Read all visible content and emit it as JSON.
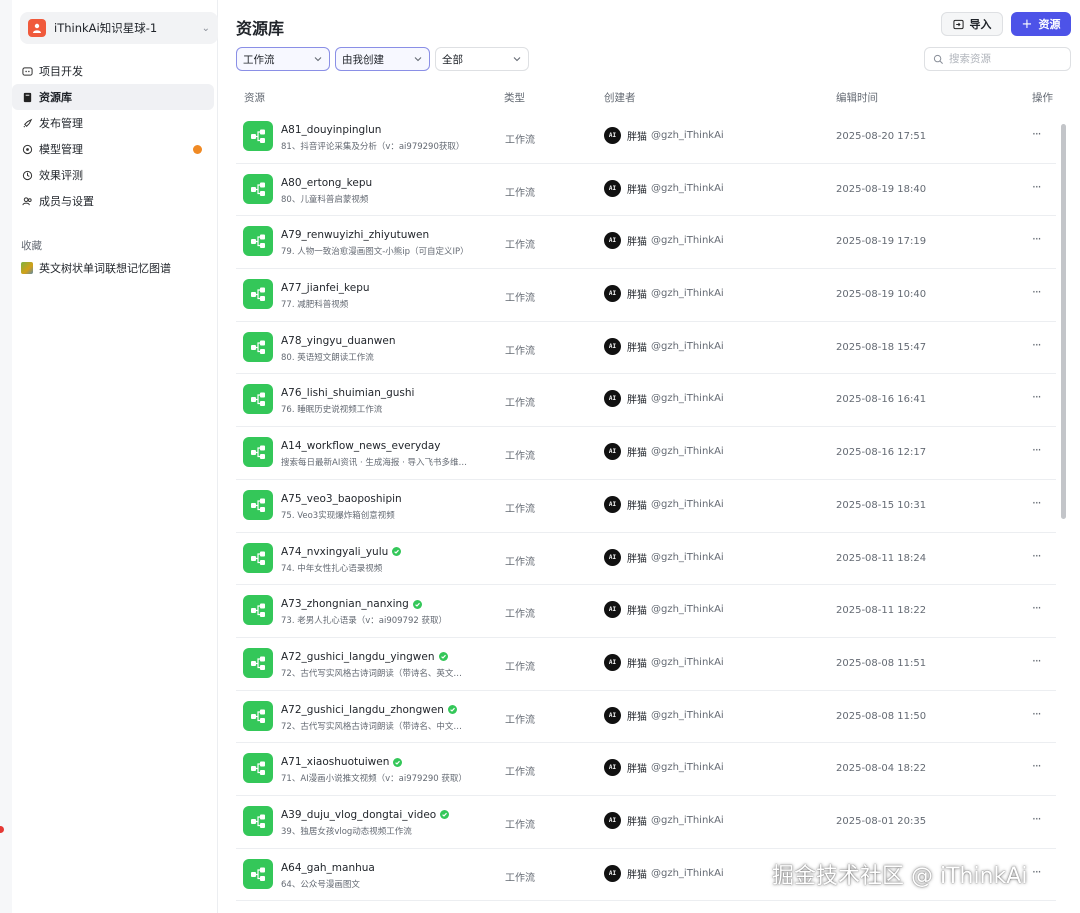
{
  "sidebar": {
    "space_name": "iThinkAi知识星球-1",
    "items": [
      {
        "label": "项目开发",
        "icon": "project-icon",
        "active": false
      },
      {
        "label": "资源库",
        "icon": "library-icon",
        "active": true
      },
      {
        "label": "发布管理",
        "icon": "rocket-icon",
        "active": false
      },
      {
        "label": "模型管理",
        "icon": "model-icon",
        "active": false,
        "badge": true
      },
      {
        "label": "效果评测",
        "icon": "evaluation-icon",
        "active": false
      },
      {
        "label": "成员与设置",
        "icon": "members-icon",
        "active": false
      }
    ],
    "favorites_label": "收藏",
    "favorites": [
      {
        "label": "英文树状单词联想记忆图谱"
      }
    ]
  },
  "header": {
    "title": "资源库",
    "import_label": "导入",
    "add_label": "资源"
  },
  "filters": {
    "type": "工作流",
    "creator": "由我创建",
    "scope": "全部",
    "search_placeholder": "搜索资源"
  },
  "table": {
    "columns": {
      "resource": "资源",
      "type": "类型",
      "creator": "创建者",
      "time": "编辑时间",
      "actions": "操作"
    },
    "rows": [
      {
        "name": "A81_douyinpinglun",
        "desc": "81、抖音评论采集及分析（v：ai979290获取）",
        "type": "工作流",
        "creator": "胖猫",
        "handle": "@gzh_iThinkAi",
        "time": "2025-08-20 17:51",
        "verified": false
      },
      {
        "name": "A80_ertong_kepu",
        "desc": "80、儿童科普启蒙视频",
        "type": "工作流",
        "creator": "胖猫",
        "handle": "@gzh_iThinkAi",
        "time": "2025-08-19 18:40",
        "verified": false
      },
      {
        "name": "A79_renwuyizhi_zhiyutuwen",
        "desc": "79. 人物一致治愈漫画图文-小熊ip（可自定义IP）",
        "type": "工作流",
        "creator": "胖猫",
        "handle": "@gzh_iThinkAi",
        "time": "2025-08-19 17:19",
        "verified": false
      },
      {
        "name": "A77_jianfei_kepu",
        "desc": "77. 减肥科普视频",
        "type": "工作流",
        "creator": "胖猫",
        "handle": "@gzh_iThinkAi",
        "time": "2025-08-19 10:40",
        "verified": false
      },
      {
        "name": "A78_yingyu_duanwen",
        "desc": "80. 英语短文朗读工作流",
        "type": "工作流",
        "creator": "胖猫",
        "handle": "@gzh_iThinkAi",
        "time": "2025-08-18 15:47",
        "verified": false
      },
      {
        "name": "A76_lishi_shuimian_gushi",
        "desc": "76. 睡眠历史说视频工作流",
        "type": "工作流",
        "creator": "胖猫",
        "handle": "@gzh_iThinkAi",
        "time": "2025-08-16 16:41",
        "verified": false
      },
      {
        "name": "A14_workflow_news_everyday",
        "desc": "搜索每日最新AI资讯 · 生成海报 · 导入飞书多维…",
        "type": "工作流",
        "creator": "胖猫",
        "handle": "@gzh_iThinkAi",
        "time": "2025-08-16 12:17",
        "verified": false
      },
      {
        "name": "A75_veo3_baoposhipin",
        "desc": "75. Veo3实现爆炸箱创意视频",
        "type": "工作流",
        "creator": "胖猫",
        "handle": "@gzh_iThinkAi",
        "time": "2025-08-15 10:31",
        "verified": false
      },
      {
        "name": "A74_nvxingyali_yulu",
        "desc": "74. 中年女性扎心语录视频",
        "type": "工作流",
        "creator": "胖猫",
        "handle": "@gzh_iThinkAi",
        "time": "2025-08-11 18:24",
        "verified": true
      },
      {
        "name": "A73_zhongnian_nanxing",
        "desc": "73. 老男人扎心语录（v：ai909792 获取）",
        "type": "工作流",
        "creator": "胖猫",
        "handle": "@gzh_iThinkAi",
        "time": "2025-08-11 18:22",
        "verified": true
      },
      {
        "name": "A72_gushici_langdu_yingwen",
        "desc": "72、古代写实风格古诗词朗读（带诗名、英文…",
        "type": "工作流",
        "creator": "胖猫",
        "handle": "@gzh_iThinkAi",
        "time": "2025-08-08 11:51",
        "verified": true
      },
      {
        "name": "A72_gushici_langdu_zhongwen",
        "desc": "72、古代写实风格古诗词朗读（带诗名、中文…",
        "type": "工作流",
        "creator": "胖猫",
        "handle": "@gzh_iThinkAi",
        "time": "2025-08-08 11:50",
        "verified": true
      },
      {
        "name": "A71_xiaoshuotuiwen",
        "desc": "71、AI漫画小说推文视频（v：ai979290 获取）",
        "type": "工作流",
        "creator": "胖猫",
        "handle": "@gzh_iThinkAi",
        "time": "2025-08-04 18:22",
        "verified": true
      },
      {
        "name": "A39_duju_vlog_dongtai_video",
        "desc": "39、独居女孩vlog动态视频工作流",
        "type": "工作流",
        "creator": "胖猫",
        "handle": "@gzh_iThinkAi",
        "time": "2025-08-01 20:35",
        "verified": true
      },
      {
        "name": "A64_gah_manhua",
        "desc": "64、公众号漫画图文",
        "type": "工作流",
        "creator": "胖猫",
        "handle": "@gzh_iThinkAi",
        "time": "",
        "verified": false
      }
    ]
  },
  "watermark": "掘金技术社区 @ iThinkAi",
  "colors": {
    "accent": "#4d53e8",
    "workflow_icon": "#34c759",
    "badge": "#f08a24"
  }
}
